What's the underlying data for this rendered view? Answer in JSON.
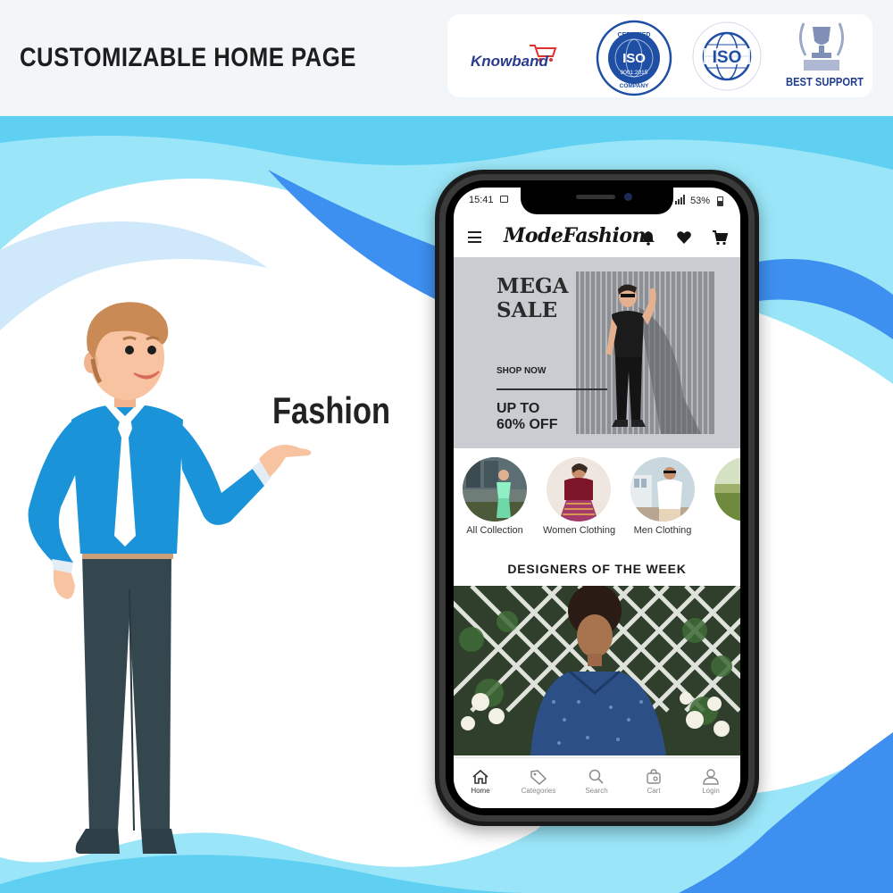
{
  "header": {
    "title": "CUSTOMIZABLE HOME PAGE",
    "brand": "Knowband",
    "badges": [
      {
        "top": "CERTIFIED",
        "middle": "ISO",
        "bottom_code": "9001:2015",
        "bottom": "COMPANY"
      },
      {
        "middle": "ISO",
        "ring_text": "International Organization for Standardization"
      },
      {
        "label": "BEST SUPPORT"
      }
    ]
  },
  "caption": "Fashion",
  "phone": {
    "status": {
      "time": "15:41",
      "battery": "53%"
    },
    "app": {
      "logo": "ModeFashion"
    },
    "banner": {
      "title": "MEGA\nSALE",
      "cta": "SHOP NOW",
      "offer": "UP TO\n60% OFF"
    },
    "categories": [
      {
        "label": "All Collection"
      },
      {
        "label": "Women Clothing"
      },
      {
        "label": "Men Clothing"
      }
    ],
    "section_title": "DESIGNERS OF THE WEEK",
    "nav": [
      {
        "label": "Home",
        "icon": "home-icon"
      },
      {
        "label": "Categories",
        "icon": "tag-icon"
      },
      {
        "label": "Search",
        "icon": "search-icon"
      },
      {
        "label": "Cart",
        "icon": "cart-icon"
      },
      {
        "label": "Login",
        "icon": "user-icon"
      }
    ]
  },
  "colors": {
    "shirt_blue": "#1a93d9",
    "brand_blue": "#1f4fa5",
    "wave_light": "#8fe0f7",
    "wave_dark": "#3d8ff0"
  }
}
